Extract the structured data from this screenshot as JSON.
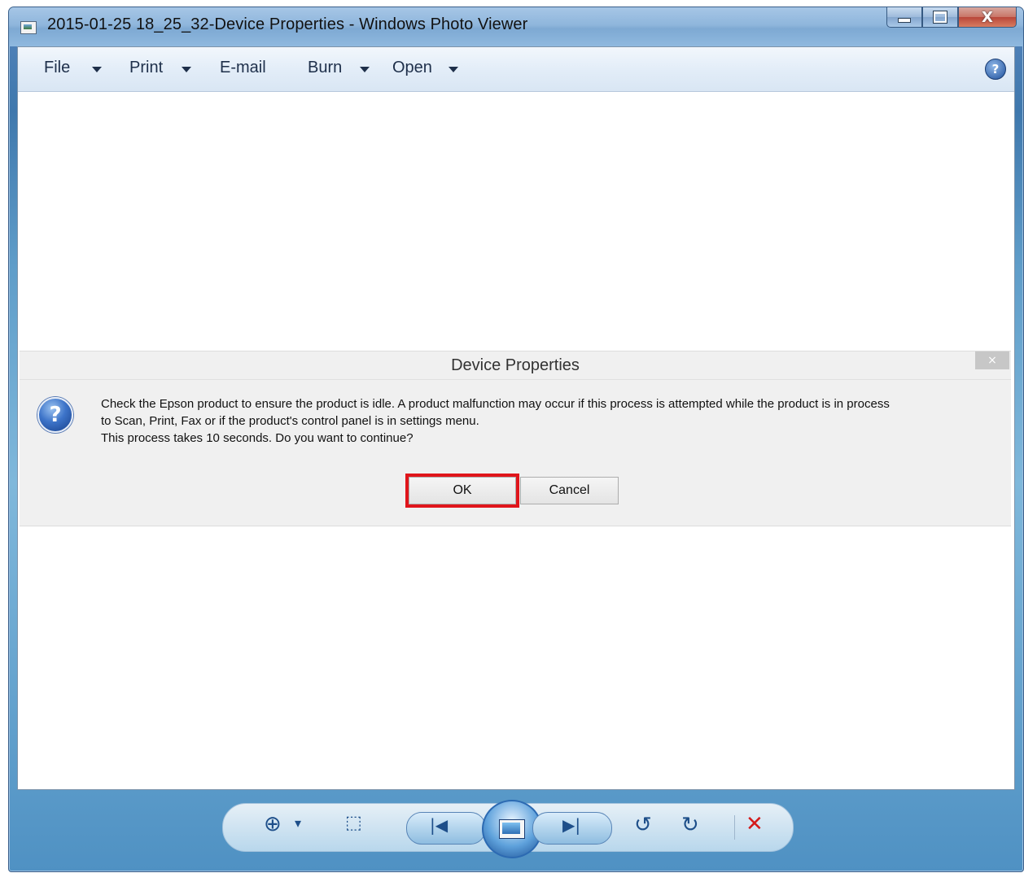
{
  "window": {
    "title": "2015-01-25 18_25_32-Device Properties - Windows Photo Viewer",
    "buttons": {
      "minimize": "–",
      "maximize": "□",
      "close": "X"
    }
  },
  "menubar": {
    "items": [
      {
        "label": "File",
        "has_arrow": true
      },
      {
        "label": "Print",
        "has_arrow": true
      },
      {
        "label": "E-mail",
        "has_arrow": false
      },
      {
        "label": "Burn",
        "has_arrow": true
      },
      {
        "label": "Open",
        "has_arrow": true
      }
    ],
    "help_icon": "help-icon",
    "help_glyph": "?"
  },
  "dialog": {
    "title": "Device Properties",
    "close_glyph": "×",
    "icon": "question-icon",
    "icon_glyph": "?",
    "message_line1": "Check the Epson product to ensure the product is idle. A product malfunction may occur if this process is attempted while the product is in process",
    "message_line2": "to Scan, Print, Fax or if the product's control panel is in settings menu.",
    "message_line3": "This process takes 10 seconds. Do you want to continue?",
    "ok_label": "OK",
    "cancel_label": "Cancel",
    "highlight_color": "#e0151b"
  },
  "toolbar": {
    "zoom_glyph": "⊕",
    "zoom_arrow": "▾",
    "fit_glyph": "⬚",
    "prev_glyph": "|◀",
    "next_glyph": "▶|",
    "rotate_ccw_glyph": "↺",
    "rotate_cw_glyph": "↻",
    "delete_glyph": "✕"
  }
}
